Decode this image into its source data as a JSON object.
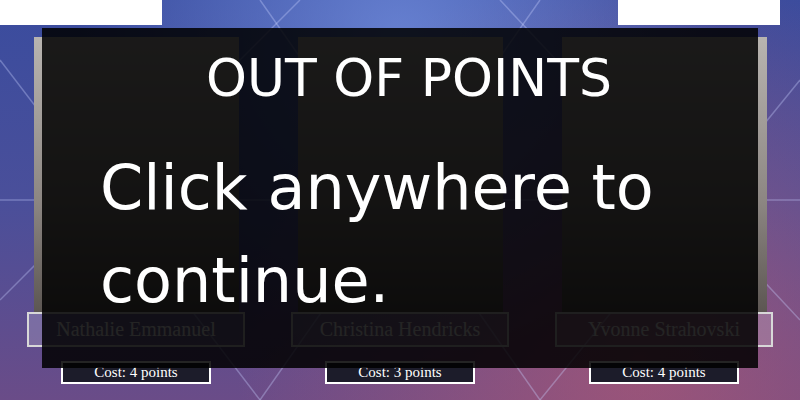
{
  "cards": [
    {
      "name": "Nathalie Emmanuel",
      "cost": "Cost: 4 points"
    },
    {
      "name": "Christina Hendricks",
      "cost": "Cost: 3 points"
    },
    {
      "name": "Yvonne Strahovski",
      "cost": "Cost: 4 points"
    }
  ],
  "overlay": {
    "title": "OUT OF POINTS",
    "message": "Click anywhere to continue."
  }
}
